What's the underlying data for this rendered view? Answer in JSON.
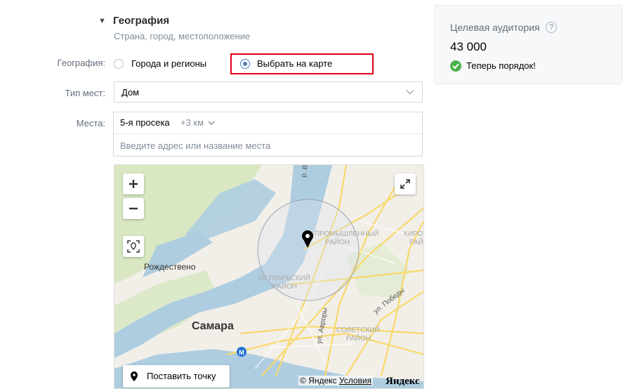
{
  "section": {
    "title": "География",
    "subtitle": "Страна, город, местоположение"
  },
  "geo": {
    "label": "География:",
    "options": [
      {
        "label": "Города и регионы",
        "selected": false
      },
      {
        "label": "Выбрать на карте",
        "selected": true
      }
    ]
  },
  "place_type": {
    "label": "Тип мест:",
    "value": "Дом"
  },
  "places": {
    "label": "Места:",
    "tag": "5-я просека",
    "radius": "+3 км",
    "placeholder": "Введите адрес или название места"
  },
  "map": {
    "labels": {
      "rozhdestveno": "Рождествено",
      "samara": "Самара",
      "promyshlenny": "ПРОМЫШЛЕННЫЙ",
      "promyshlenny2": "РАЙОН",
      "kirovsky": "КИРОВ",
      "kirovsky2": "РАЙОН",
      "oktyabrsky": "ОКТЯБРЬСКИЙ",
      "oktyabrsky2": "РАЙОН",
      "sovetsky": "СОВЕТСКИЙ",
      "sovetsky2": "РАЙОН",
      "avrory": "ул. Авроры",
      "pobedy": "ул. Победы",
      "river": "р. В"
    },
    "put_point_label": "Поставить точку",
    "copyright": "© Яндекс",
    "terms_link": "Условия",
    "logo": "Яндекс"
  },
  "audience": {
    "title": "Целевая аудитория",
    "help": "?",
    "count": "43 000",
    "status": "Теперь порядок!"
  },
  "colors": {
    "accent": "#5181b8",
    "highlight": "#e2001a",
    "ok": "#4bb34b"
  }
}
